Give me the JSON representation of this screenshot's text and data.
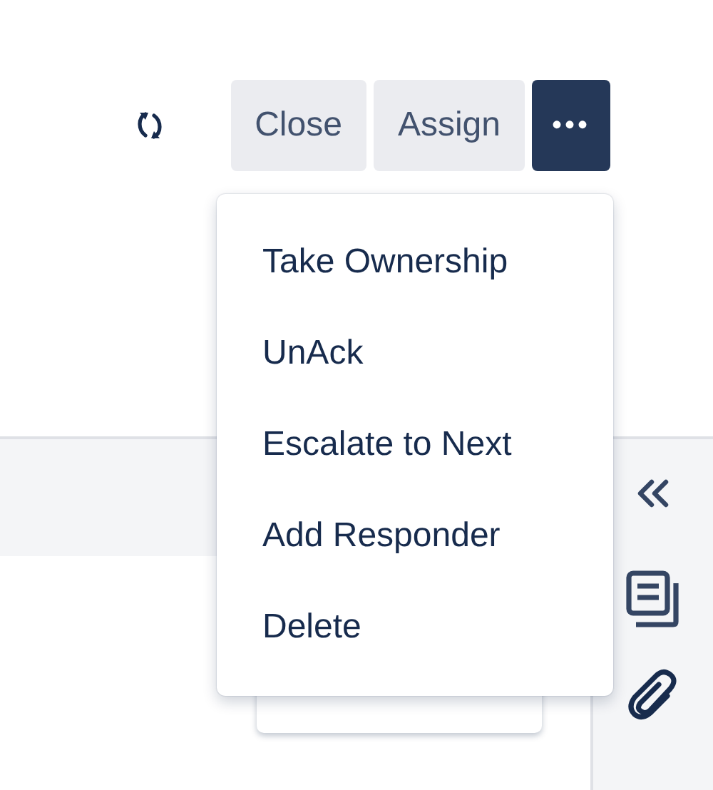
{
  "toolbar": {
    "buttons": [
      {
        "label": "Close",
        "kind": "plain",
        "selected": false
      },
      {
        "label": "Assign",
        "kind": "plain",
        "selected": false
      },
      {
        "label": "•••",
        "kind": "more",
        "selected": true
      }
    ]
  },
  "menu": {
    "items": [
      {
        "label": "Take Ownership"
      },
      {
        "label": "UnAck"
      },
      {
        "label": "Escalate to Next"
      },
      {
        "label": "Add Responder"
      },
      {
        "label": "Delete"
      }
    ]
  }
}
